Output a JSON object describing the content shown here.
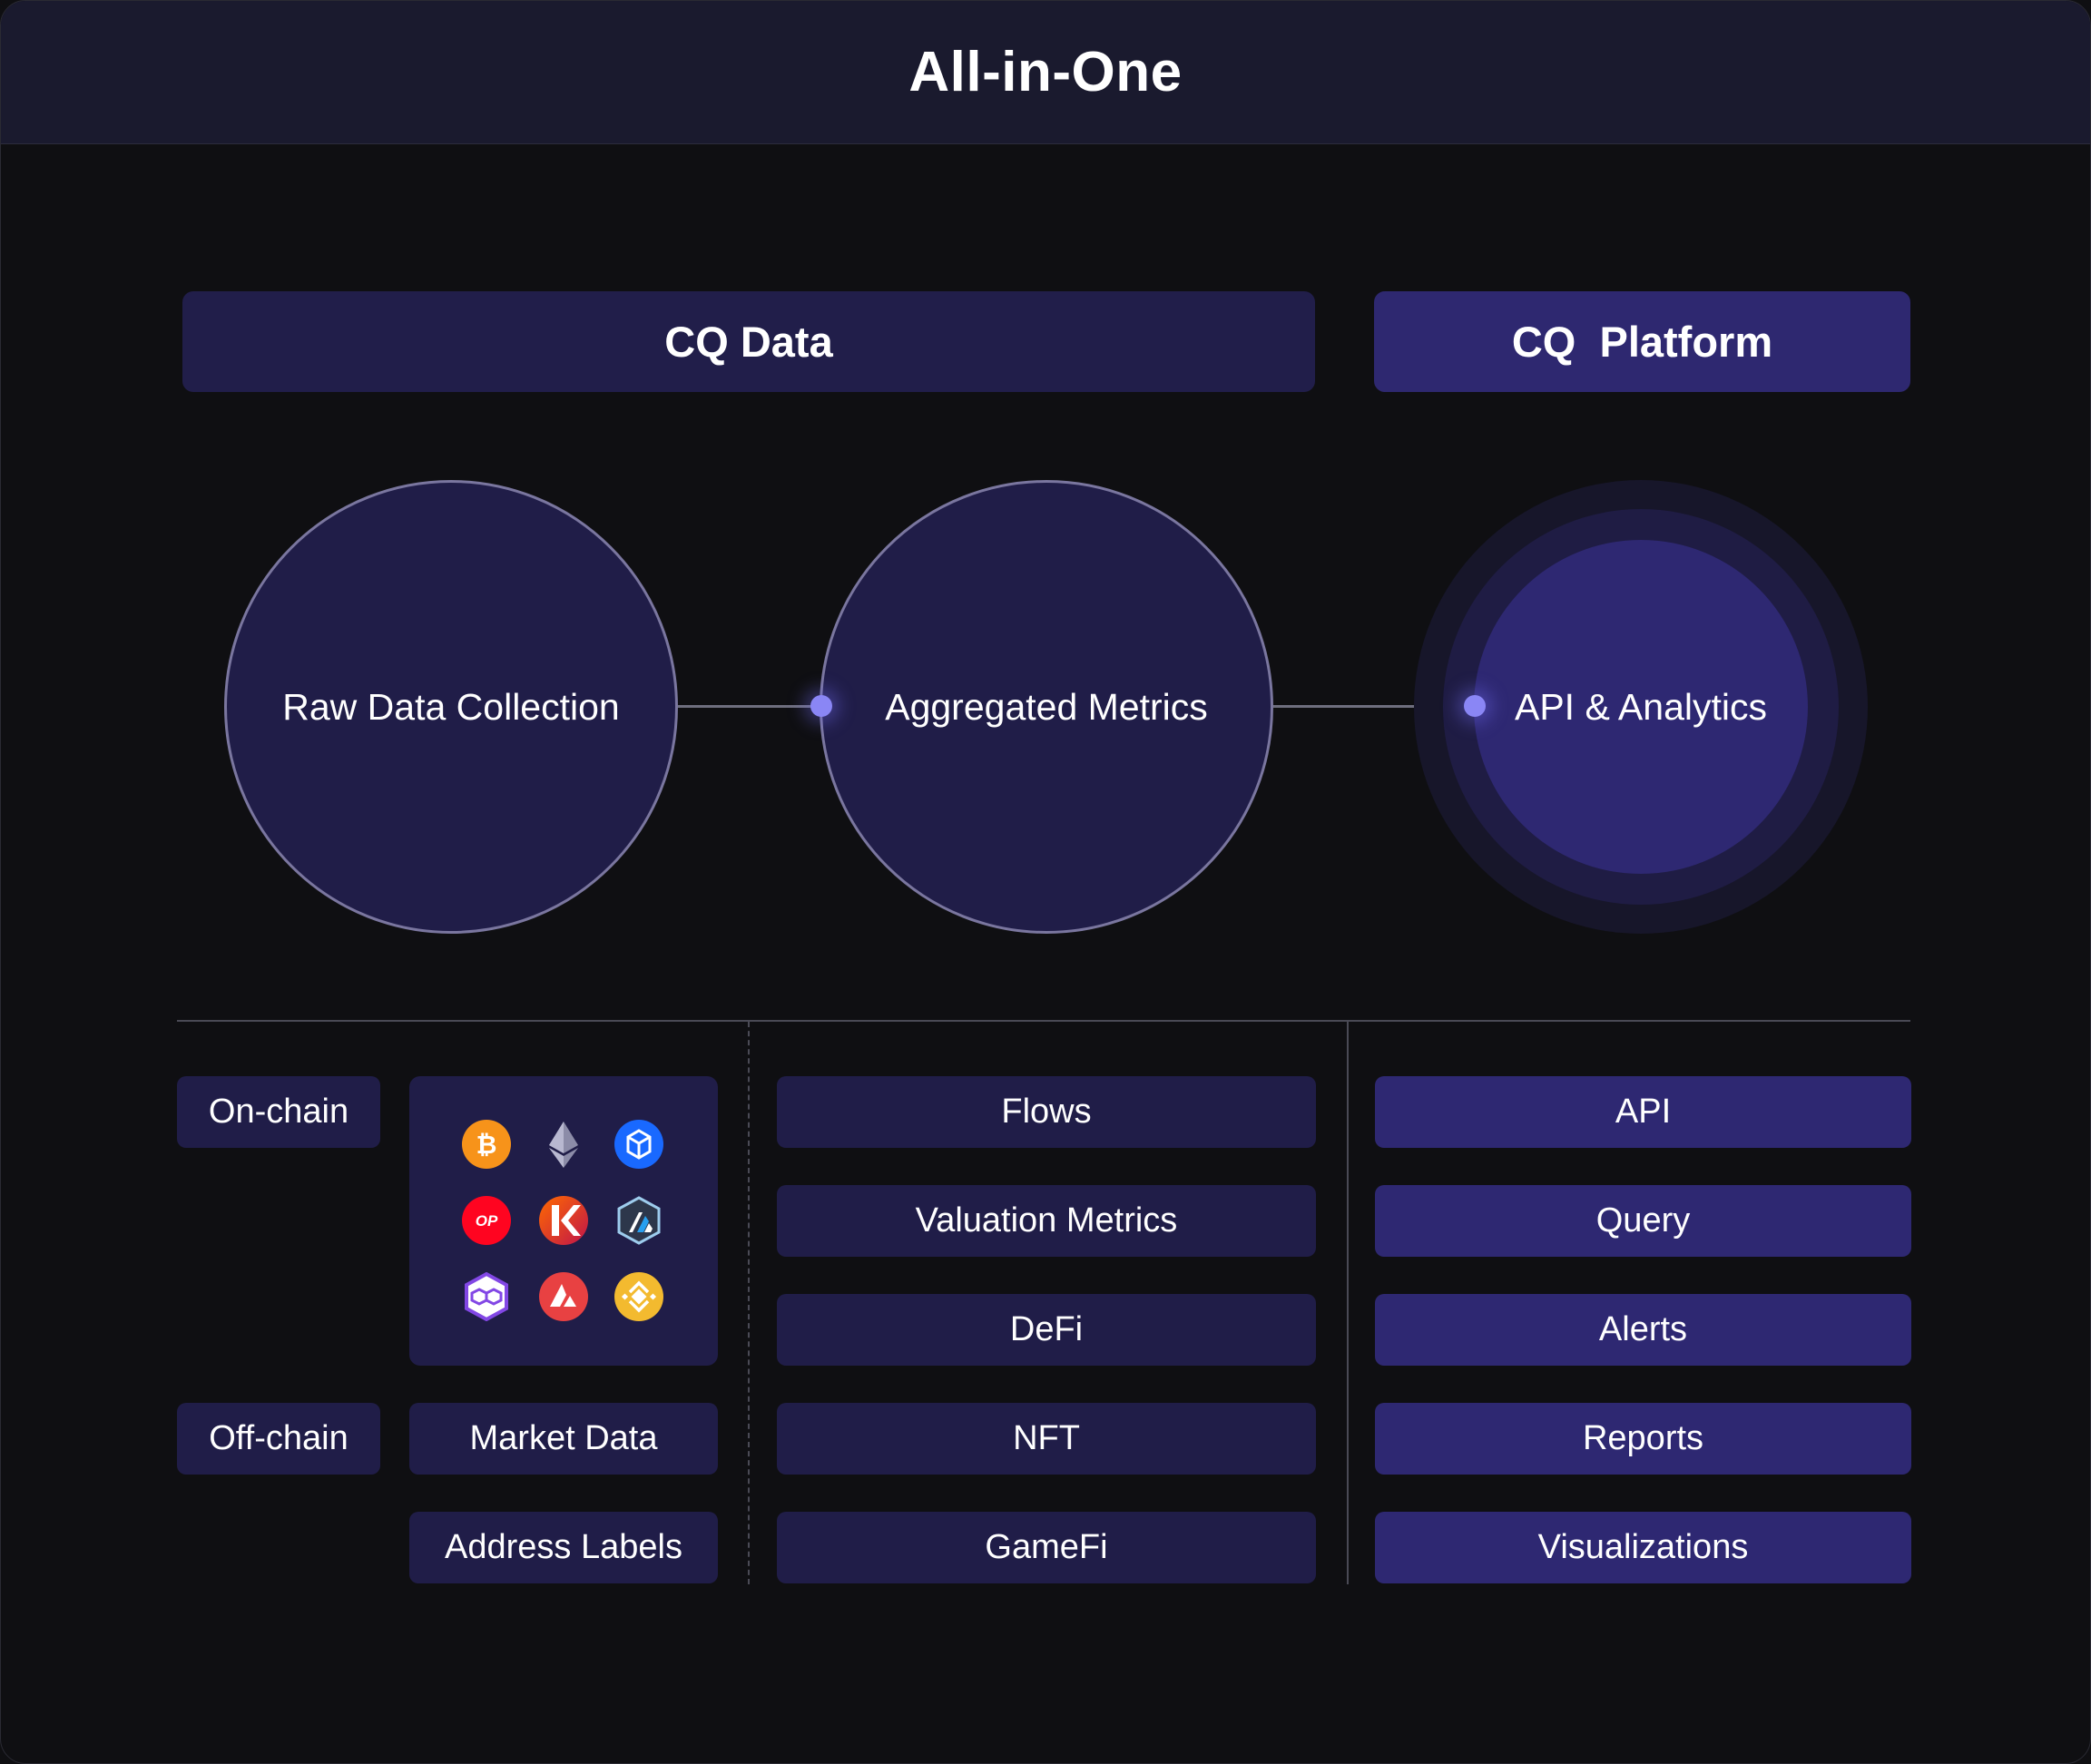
{
  "title": "All-in-One",
  "sections": {
    "data_header": "CQ Data",
    "platform_header": "CQ  Platform"
  },
  "stages": {
    "raw": "Raw Data Collection",
    "aggregated": "Aggregated Metrics",
    "api": "API & Analytics"
  },
  "sources": {
    "onchain_label": "On-chain",
    "offchain_label": "Off-chain",
    "offchain_items": [
      "Market Data",
      "Address Labels"
    ],
    "chain_icons": [
      "bitcoin-icon",
      "ethereum-icon",
      "fantom-icon",
      "optimism-icon",
      "kava-icon",
      "arbitrum-icon",
      "polygon-icon",
      "avalanche-icon",
      "bnb-icon"
    ],
    "op_text": "OP"
  },
  "metrics": [
    "Flows",
    "Valuation Metrics",
    "DeFi",
    "NFT",
    "GameFi"
  ],
  "platform": [
    "API",
    "Query",
    "Alerts",
    "Reports",
    "Visualizations"
  ],
  "colors": {
    "background": "#0f0f12",
    "topbar": "#1a1a2e",
    "data_panel": "#201d48",
    "platform_panel": "#2e2872",
    "accent_dot": "#8a86f5"
  }
}
